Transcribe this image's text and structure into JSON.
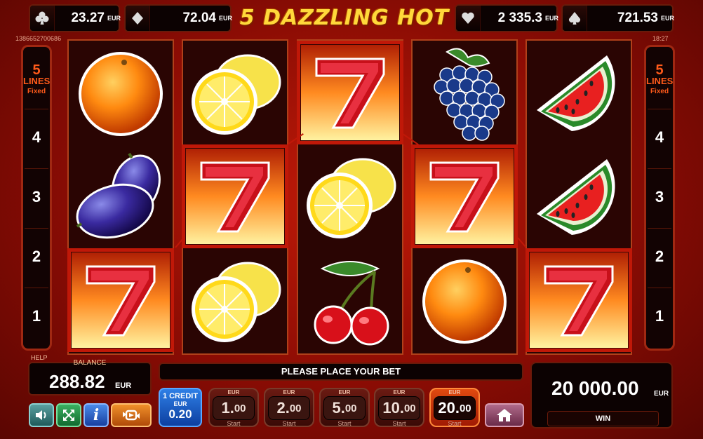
{
  "title": "5 DAZZLING HOT",
  "session_id": "1386652700686",
  "clock": "18:27",
  "jackpots": [
    {
      "suit": "club-icon",
      "value": "23.27",
      "currency": "EUR"
    },
    {
      "suit": "diamond-icon",
      "value": "72.04",
      "currency": "EUR"
    },
    {
      "suit": "heart-icon",
      "value": "2 335.3",
      "currency": "EUR"
    },
    {
      "suit": "spade-icon",
      "value": "721.53",
      "currency": "EUR"
    }
  ],
  "lines_panel": {
    "count": "5",
    "word": "LINES",
    "mode": "Fixed",
    "numbers": [
      "4",
      "3",
      "2",
      "1"
    ]
  },
  "reels": [
    [
      "orange",
      "plum",
      "seven"
    ],
    [
      "lemon",
      "seven",
      "lemon"
    ],
    [
      "seven",
      "lemon",
      "cherry"
    ],
    [
      "grapes",
      "seven",
      "orange"
    ],
    [
      "watermelon",
      "watermelon",
      "seven"
    ]
  ],
  "help_label": "HELP",
  "balance": {
    "label": "BALANCE",
    "value": "288.82",
    "currency": "EUR"
  },
  "message": "PLEASE PLACE YOUR BET",
  "credit": {
    "line1": "1 CREDIT",
    "line2": "EUR",
    "value": "0.20"
  },
  "bets": [
    {
      "currency": "EUR",
      "int": "1.",
      "dec": "00",
      "start": "Start"
    },
    {
      "currency": "EUR",
      "int": "2.",
      "dec": "00",
      "start": "Start"
    },
    {
      "currency": "EUR",
      "int": "5.",
      "dec": "00",
      "start": "Start"
    },
    {
      "currency": "EUR",
      "int": "10.",
      "dec": "00",
      "start": "Start"
    },
    {
      "currency": "EUR",
      "int": "20.",
      "dec": "00",
      "start": "Start"
    }
  ],
  "win": {
    "value": "20 000.00",
    "currency": "EUR",
    "label": "WIN"
  },
  "colors": {
    "accent": "#ffd83a",
    "line": "#c01808",
    "background": "#a0140a"
  }
}
